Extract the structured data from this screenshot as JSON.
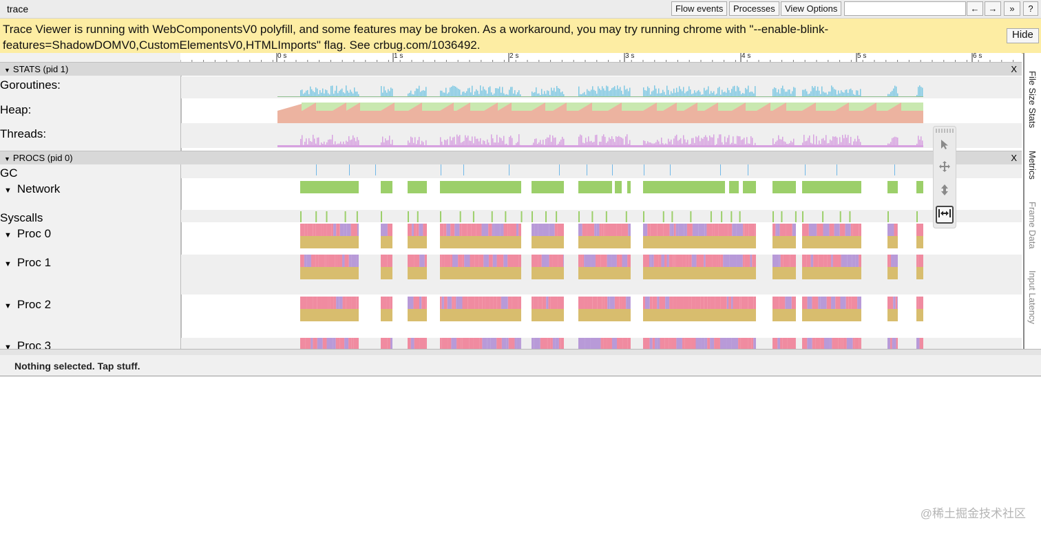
{
  "window": {
    "title": "trace"
  },
  "toolbar": {
    "flow_events": "Flow events",
    "processes": "Processes",
    "view_options": "View Options",
    "search_value": "",
    "prev": "←",
    "next": "→",
    "more": "»",
    "help": "?"
  },
  "warning": {
    "text": "Trace Viewer is running with WebComponentsV0 polyfill, and some features may be broken. As a workaround, you may try running chrome with \"--enable-blink-features=ShadowDOMV0,CustomElementsV0,HTMLImports\" flag. See crbug.com/1036492.",
    "hide_label": "Hide"
  },
  "ruler": {
    "ticks": [
      "0 s",
      "1 s",
      "2 s",
      "3 s",
      "4 s",
      "5 s",
      "6 s"
    ]
  },
  "stats_process": {
    "header": "STATS (pid 1)",
    "close": "X",
    "rows": [
      "Goroutines:",
      "Heap:",
      "Threads:"
    ]
  },
  "procs_process": {
    "header": "PROCS (pid 0)",
    "close": "X",
    "rows": [
      "GC",
      "Network",
      "Syscalls",
      "Proc 0",
      "Proc 1",
      "Proc 2",
      "Proc 3"
    ]
  },
  "side_tabs": [
    "File Size Stats",
    "Metrics",
    "Frame Data",
    "Input Latency"
  ],
  "toolbox": {
    "tools": [
      "select-tool",
      "pan-tool",
      "zoom-tool",
      "timing-tool"
    ],
    "active": "timing-tool"
  },
  "status": {
    "text": "Nothing selected. Tap stuff."
  },
  "watermark": "@稀土掘金技术社区",
  "colors": {
    "goroutines": "#7ec8e3",
    "heap_alloc": "#ecb3a0",
    "heap_next_gc": "#c9e8b0",
    "threads": "#d7a1e0",
    "network": "#9ccf6a",
    "gc": "#6fb7e8",
    "proc_pink": "#f08ba0",
    "proc_purple": "#b89ad8",
    "proc_gold": "#d8bd6e"
  }
}
